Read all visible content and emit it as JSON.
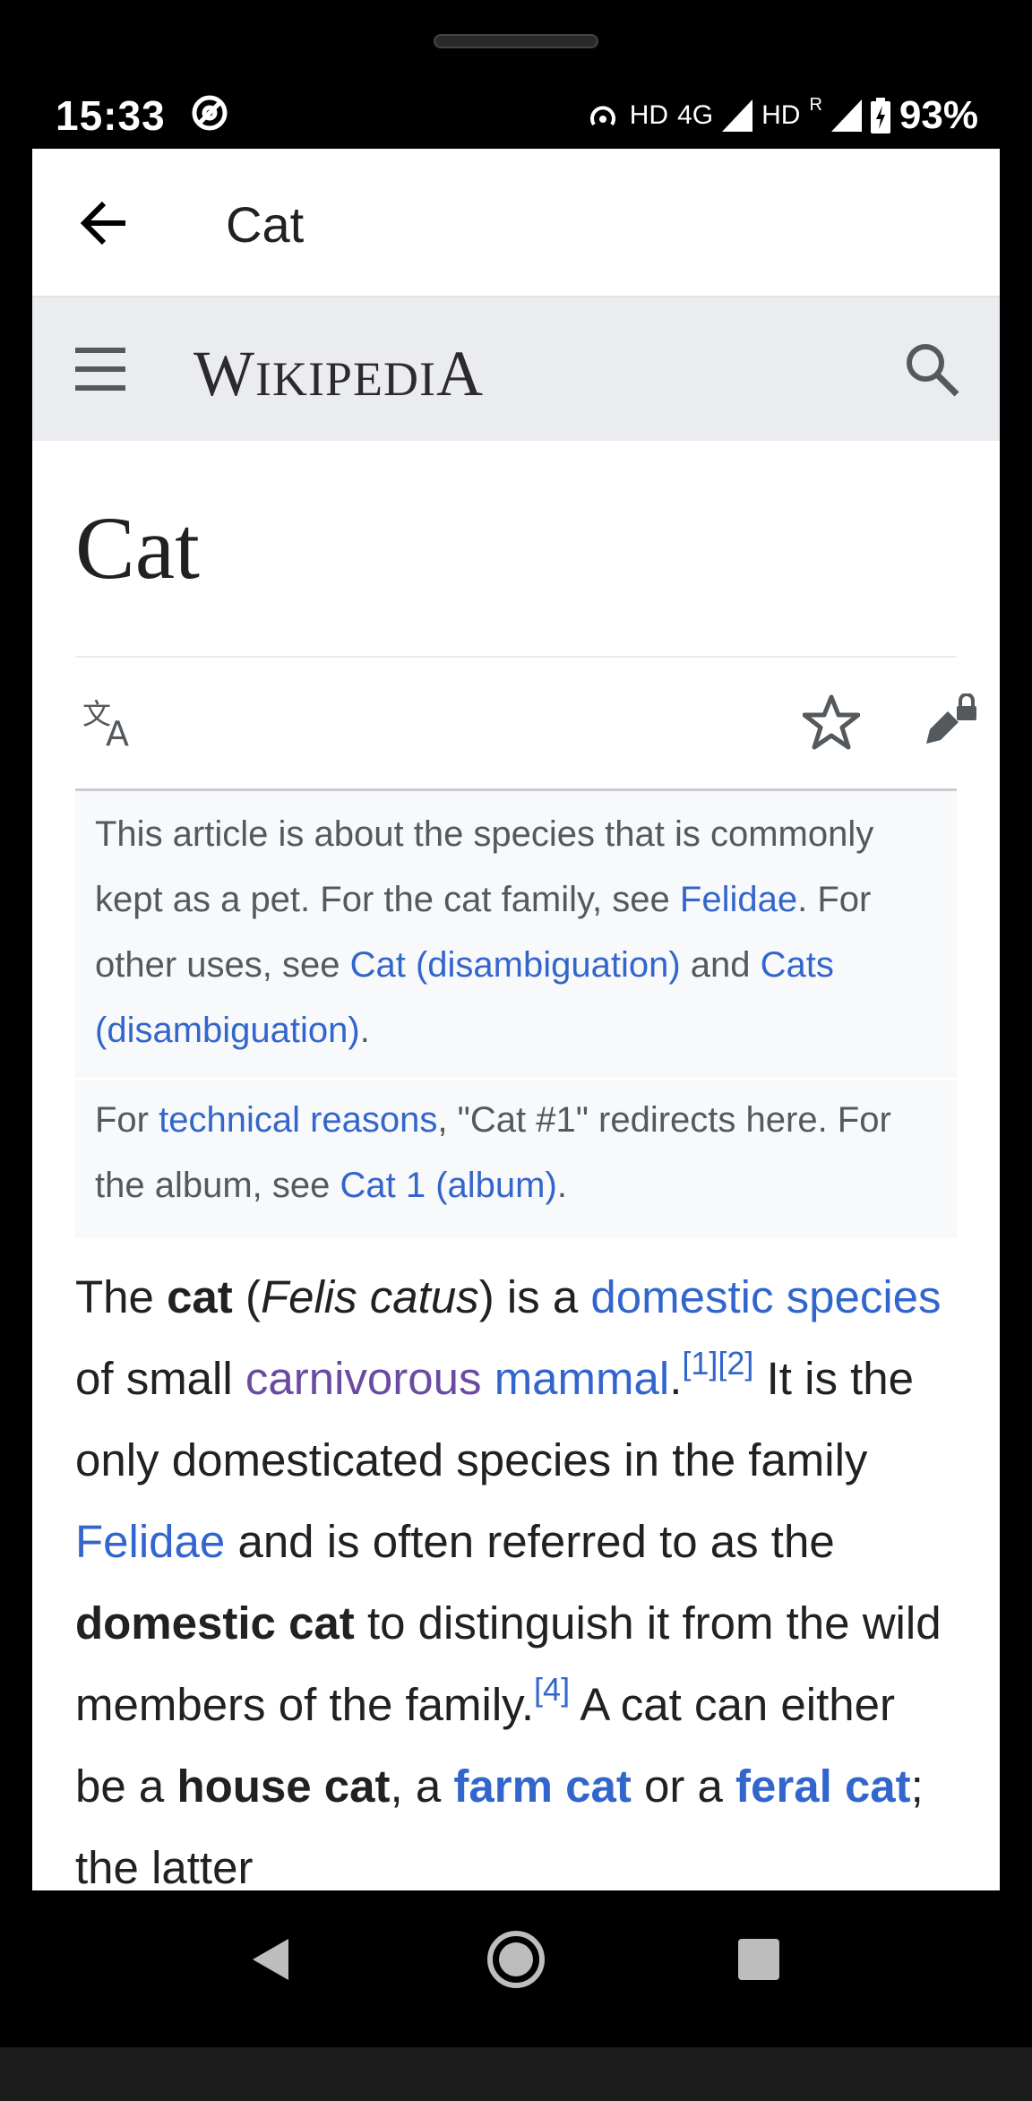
{
  "status_bar": {
    "time": "15:33",
    "network_1": "HD",
    "network_type": "4G",
    "network_2": "HD",
    "roaming": "R",
    "battery": "93%"
  },
  "app_bar": {
    "title": "Cat",
    "back_icon": "arrow-left-icon"
  },
  "wiki_header": {
    "wordmark_first": "W",
    "wordmark_mid": "IKIPEDI",
    "wordmark_last": "A",
    "menu_icon": "hamburger-icon",
    "search_icon": "search-icon"
  },
  "article": {
    "title": "Cat",
    "actions": [
      "language-icon",
      "star-icon",
      "edit-lock-icon"
    ],
    "hatnote1": {
      "text1": "This article is about the species that is commonly kept as a pet. For the cat family, see ",
      "link1": "Felidae",
      "text2": ". For other uses, see ",
      "link2": "Cat (disambiguation)",
      "text3": " and ",
      "link3": "Cats (disambiguation)",
      "text4": "."
    },
    "hatnote2": {
      "text1": "For ",
      "link1": "technical reasons",
      "text2": ", \"Cat #1\" redirects here. For the album, see ",
      "link2": "Cat 1 (album)",
      "text3": "."
    },
    "lead": {
      "t1": "The ",
      "b1": "cat",
      "t2": " (",
      "i1": "Felis catus",
      "t3": ") is a ",
      "l1": "domestic species",
      "t4": " of small ",
      "l2": "carnivorous",
      "t5": " ",
      "l3": "mammal",
      "t6": ".",
      "ref1": "[1]",
      "ref2": "[2]",
      "t7": " It is the only domesticated species in the family ",
      "l4": "Felidae",
      "t8": " and is often referred to as the ",
      "b2": "domestic cat",
      "t9": " to distinguish it from the wild members of the family.",
      "ref3": "[4]",
      "t10": " A cat can either be a ",
      "b3": "house cat",
      "t11": ", a ",
      "l5": "farm cat",
      "t12": " or a ",
      "l6": "feral cat",
      "t13": "; the latter"
    }
  },
  "nav_bar": {
    "back": "triangle-back-icon",
    "home": "circle-home-icon",
    "recents": "square-recents-icon"
  }
}
